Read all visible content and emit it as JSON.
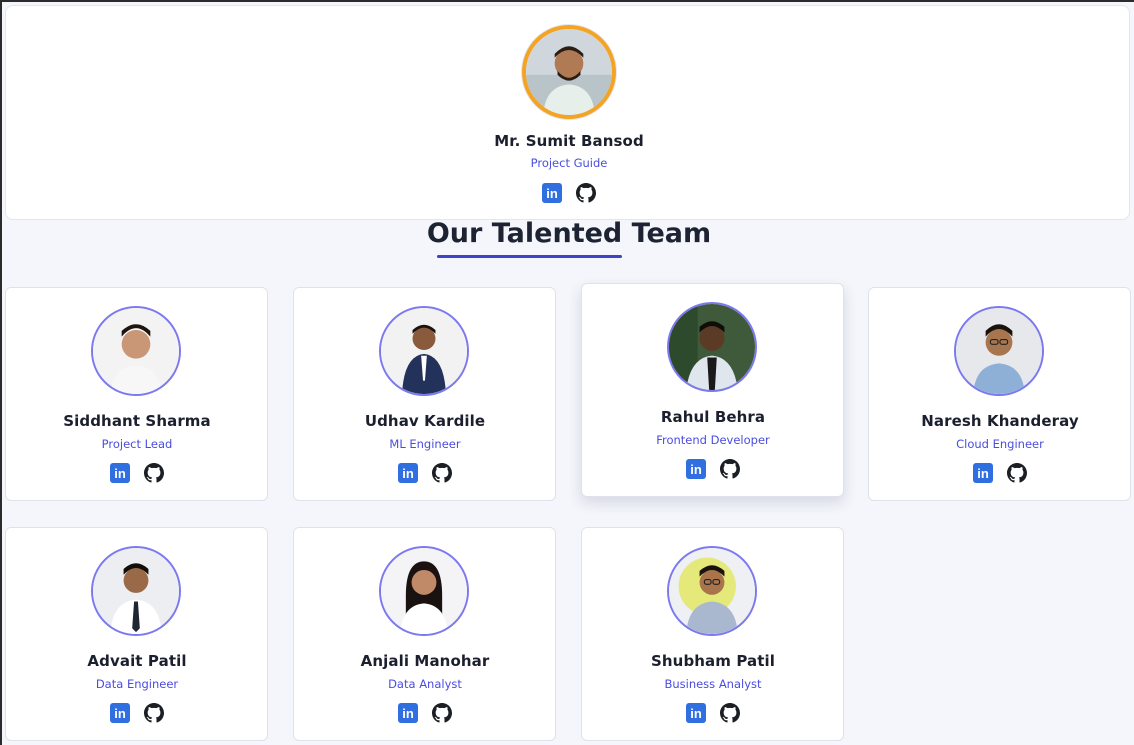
{
  "guide": {
    "name": "Mr. Sumit Bansod",
    "role": "Project Guide",
    "linkedin_label": "in",
    "links": [
      "linkedin-icon",
      "github-icon"
    ]
  },
  "section": {
    "title": "Our Talented Team"
  },
  "team": [
    {
      "name": "Siddhant Sharma",
      "role": "Project Lead",
      "linkedin_label": "in"
    },
    {
      "name": "Udhav Kardile",
      "role": "ML Engineer",
      "linkedin_label": "in"
    },
    {
      "name": "Rahul Behra",
      "role": "Frontend Developer",
      "linkedin_label": "in"
    },
    {
      "name": "Naresh Khanderay",
      "role": "Cloud Engineer",
      "linkedin_label": "in"
    },
    {
      "name": "Advait Patil",
      "role": "Data Engineer",
      "linkedin_label": "in"
    },
    {
      "name": "Anjali Manohar",
      "role": "Data Analyst",
      "linkedin_label": "in"
    },
    {
      "name": "Shubham Patil",
      "role": "Business Analyst",
      "linkedin_label": "in"
    }
  ],
  "colors": {
    "accent": "#4a4de0",
    "linkedin": "#2f6fe0",
    "avatar_ring": "#7c79f0",
    "guide_ring": "#f4a323",
    "title_underline": "#3b43c8"
  }
}
